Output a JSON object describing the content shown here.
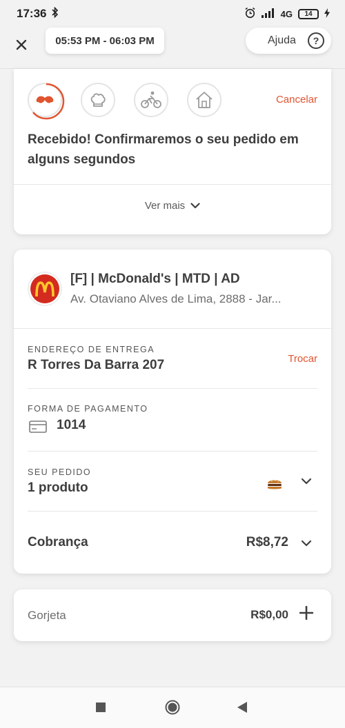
{
  "status_bar": {
    "time": "17:36",
    "network": "4G",
    "battery": "14"
  },
  "header": {
    "time_window": "05:53 PM - 06:03 PM",
    "help_label": "Ajuda"
  },
  "status": {
    "cancel_label": "Cancelar",
    "message": "Recebido! Confirmaremos o seu pedido em alguns segundos",
    "see_more_label": "Ver mais",
    "steps": [
      {
        "icon": "mustache-icon",
        "active": true
      },
      {
        "icon": "chef-hat-icon",
        "active": false
      },
      {
        "icon": "cyclist-icon",
        "active": false
      },
      {
        "icon": "home-icon",
        "active": false
      }
    ]
  },
  "store": {
    "name": "[F] | McDonald's | MTD | AD",
    "address": "Av. Otaviano Alves de Lima, 2888 - Jar..."
  },
  "delivery": {
    "label": "ENDEREÇO DE ENTREGA",
    "address": "R Torres Da Barra 207",
    "change_label": "Trocar"
  },
  "payment": {
    "label": "FORMA DE PAGAMENTO",
    "card": "1014"
  },
  "order": {
    "label": "SEU PEDIDO",
    "summary": "1 produto"
  },
  "billing": {
    "label": "Cobrança",
    "value": "R$8,72"
  },
  "tip": {
    "label": "Gorjeta",
    "value": "R$0,00"
  },
  "colors": {
    "accent": "#e0542f",
    "mcdonalds_red": "#d32b1f",
    "mcdonalds_yellow": "#ffc72c"
  }
}
